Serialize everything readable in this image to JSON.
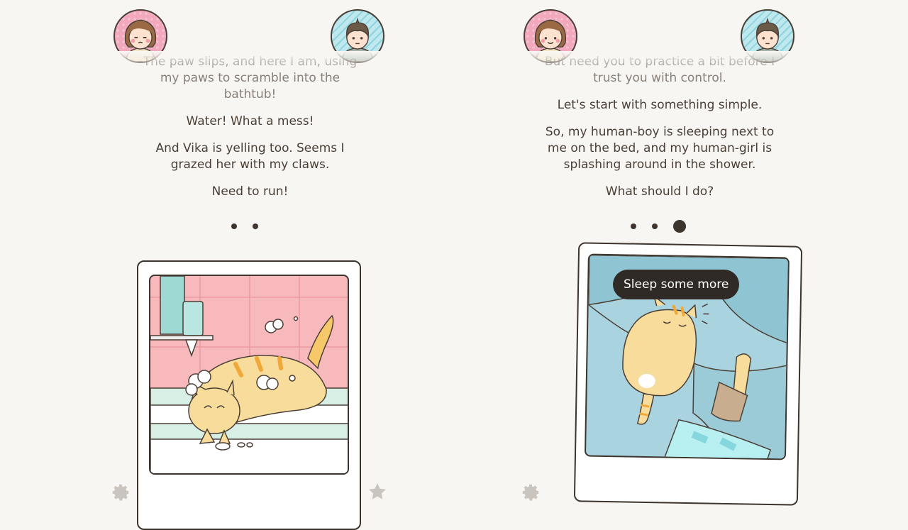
{
  "left_panel": {
    "paragraphs": [
      "The paw slips, and here I am, using my paws to scramble into the bathtub!",
      "Water! What a mess!",
      "And Vika is yelling too. Seems I grazed her with my claws.",
      "Need to run!"
    ],
    "progress_dots": 2,
    "active_dot": null
  },
  "right_panel": {
    "paragraphs": [
      "But need you to practice a bit before I trust you with control.",
      "Let's start with something simple.",
      "So, my human-boy is sleeping next to me on the bed, and my human-girl is splashing around in the shower.",
      "What should I do?"
    ],
    "progress_dots": 3,
    "active_dot": 3,
    "choice_label": "Sleep some more"
  },
  "icons": {
    "settings": "gear-icon",
    "favorite": "star-icon"
  },
  "colors": {
    "background": "#f8f6f2",
    "text": "#4a3f36",
    "tile_pink": "#f8b9bd",
    "bed_blue": "#a9d3de",
    "cat_orange": "#f6c86a"
  }
}
